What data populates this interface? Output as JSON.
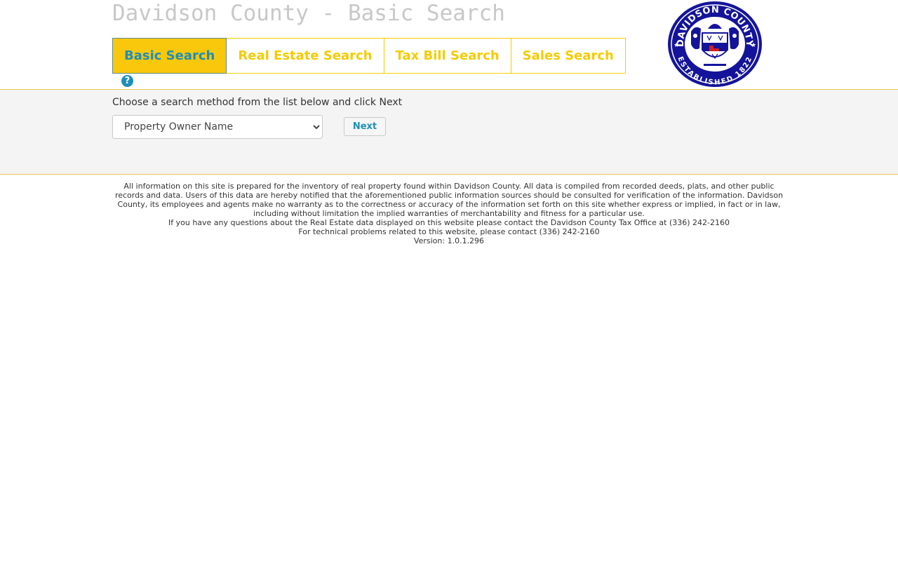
{
  "header": {
    "title": "Davidson County - Basic Search",
    "seal_top_text": "DAVIDSON COUNTY",
    "seal_bottom_text": "ESTABLISHED 1822"
  },
  "tabs": [
    {
      "label": "Basic Search",
      "active": true
    },
    {
      "label": "Real Estate Search",
      "active": false
    },
    {
      "label": "Tax Bill Search",
      "active": false
    },
    {
      "label": "Sales Search",
      "active": false
    }
  ],
  "help": {
    "glyph": "?"
  },
  "search": {
    "instruction": "Choose a search method from the list below and click Next",
    "selected_method": "Property Owner Name",
    "next_label": "Next"
  },
  "footer": {
    "disclaimer": "All information on this site is prepared for the inventory of real property found within Davidson County. All data is compiled from recorded deeds, plats, and other public records and data. Users of this data are hereby notified that the aforementioned public information sources should be consulted for verification of the information. Davidson County, its employees and agents make no warranty as to the correctness or accuracy of the information set forth on this site whether express or implied, in fact or in law, including without limitation the implied warranties of merchantability and fitness for a particular use.",
    "contact_real_estate": "If you have any questions about the Real Estate data displayed on this website please contact the Davidson County Tax Office at (336) 242-2160",
    "contact_technical": "For technical problems related to this website, please contact (336) 242-2160",
    "version": "Version: 1.0.1.296"
  },
  "colors": {
    "tab_gold": "#f5cb00",
    "active_tab_bg": "#f9c80c",
    "link_blue": "#1e8fb8",
    "seal_navy": "#14149a"
  }
}
